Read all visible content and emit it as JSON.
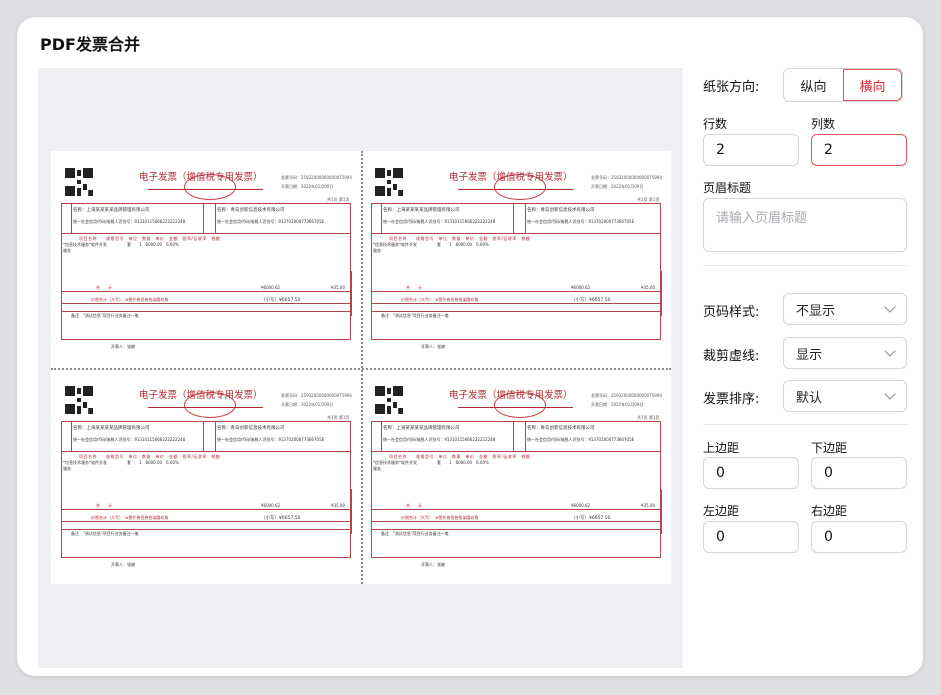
{
  "window": {
    "title": "PDF发票合并"
  },
  "invoice": {
    "title": "电子发票（增值税专用发票）",
    "number_label": "发票号码：",
    "number_value": "25932000000000075994",
    "date_label": "开票日期：",
    "date_value": "2022年01月09日",
    "page_label": "共1页 第1页",
    "buyer_name": "名称：上海某某某某品牌管理有限公司",
    "buyer_id": "统一社会信用代码/纳税人识别号：91310115666222222248",
    "seller_name": "名称：青岛创新信息技术有限公司",
    "seller_id": "统一社会信用代码/纳税人识别号：91370200077366705E",
    "columns_header": "项目名称　　规格型号　单位　数量　单价　金额　税率/征收率　税额",
    "item_line": "*信息技术服务*软件开发　　　　　套　　1　8000.00　6.00%",
    "item_line2": "服务",
    "sum_label": "合　　计",
    "sum_amount": "¥6000.62",
    "sum_tax": "¥35.00",
    "total_label": "价税合计（大写）",
    "total_words": "⊗捌仟叁佰叁拾柒圆玖角",
    "total_amount": "（小写）¥6657.50",
    "note_text": "\"测试信息\"项目行业务备注一笔",
    "note_label": "备注",
    "drawer": "开票人：张婉"
  },
  "panel": {
    "orientation_label": "纸张方向:",
    "orientation_options": [
      "纵向",
      "横向"
    ],
    "orientation_selected": "横向",
    "rows_label": "行数",
    "rows_value": "2",
    "cols_label": "列数",
    "cols_value": "2",
    "header_title_label": "页眉标题",
    "header_title_placeholder": "请输入页眉标题",
    "page_number_style_label": "页码样式:",
    "page_number_style_value": "不显示",
    "cut_line_label": "裁剪虚线:",
    "cut_line_value": "显示",
    "invoice_order_label": "发票排序:",
    "invoice_order_value": "默认",
    "margin_top_label": "上边距",
    "margin_top_value": "0",
    "margin_bottom_label": "下边距",
    "margin_bottom_value": "0",
    "margin_left_label": "左边距",
    "margin_left_value": "0",
    "margin_right_label": "右边距",
    "margin_right_value": "0"
  },
  "colors": {
    "accent": "#e0555a",
    "invoice_red": "#b02a30"
  }
}
